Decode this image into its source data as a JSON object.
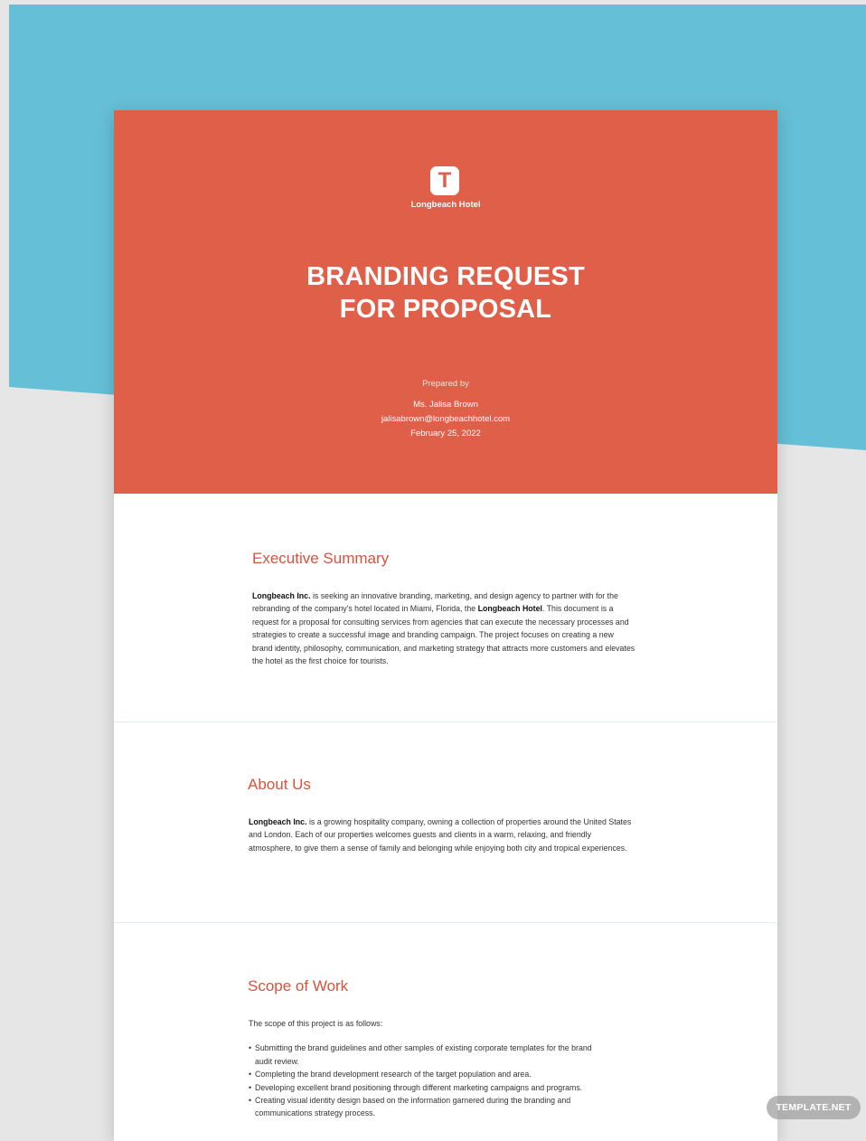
{
  "colors": {
    "background_teal": "#65bfd6",
    "background_gray": "#e6e6e6",
    "cover_red": "#e05f48",
    "heading_red": "#d9533b"
  },
  "cover": {
    "logo_letter": "T",
    "logo_name": "Longbeach Hotel",
    "title_line1": "BRANDING REQUEST",
    "title_line2": "FOR PROPOSAL",
    "prepared_label": "Prepared by",
    "name": "Ms. Jalisa Brown",
    "email": "jalisabrown@longbeachhotel.com",
    "date": "February 25, 2022"
  },
  "executive_summary": {
    "heading": "Executive Summary",
    "company": "Longbeach Inc.",
    "text_a": " is seeking an innovative branding, marketing, and design agency to partner with for the rebranding of the company's hotel located in Miami, Florida, the ",
    "hotel": "Longbeach Hotel",
    "text_b": ". This document is a request for a proposal for consulting services from agencies that can execute the necessary processes and strategies to create a successful image and branding campaign. The project focuses on creating a new brand identity, philosophy, communication, and marketing strategy that attracts more customers and elevates the hotel as the first choice for tourists."
  },
  "about_us": {
    "heading": "About Us",
    "company": "Longbeach Inc.",
    "text": " is a growing hospitality company, owning a collection of properties around the United States and London. Each of our properties welcomes guests and clients in a warm, relaxing, and friendly atmosphere, to give them a sense of family and belonging while enjoying both city and tropical experiences."
  },
  "scope_of_work": {
    "heading": "Scope of Work",
    "intro": "The scope of this project is as follows:",
    "items": [
      "Submitting the brand guidelines and other samples of existing corporate templates for the brand audit review.",
      "Completing the brand development research of the target population and area.",
      "Developing excellent brand positioning through different marketing campaigns and programs.",
      "Creating visual identity design based on the information garnered during the branding and communications strategy process."
    ]
  },
  "watermark": "TEMPLATE.NET"
}
